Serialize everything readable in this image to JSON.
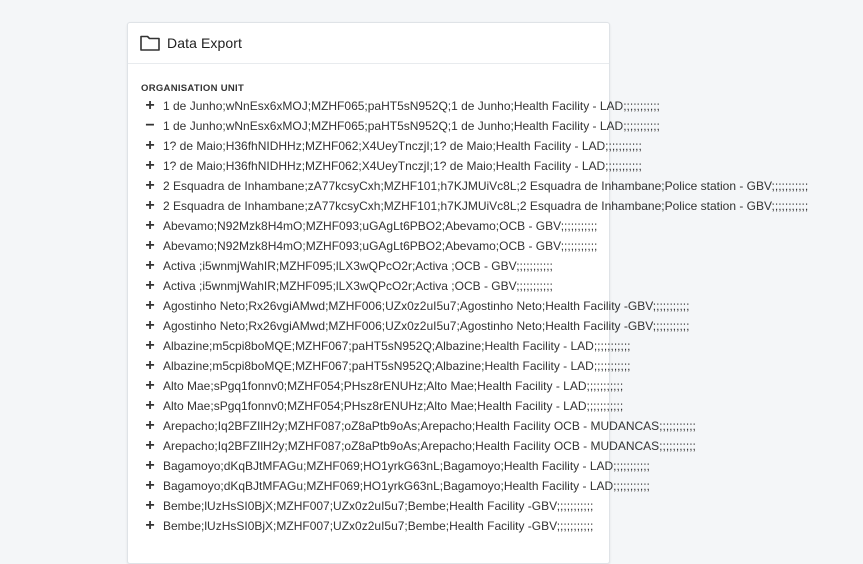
{
  "panel": {
    "title": "Data Export",
    "section_label": "ORGANISATION UNIT",
    "icon": "folder-icon"
  },
  "tree": {
    "items": [
      {
        "toggle": "+",
        "label": "1 de Junho;wNnEsx6xMOJ;MZHF065;paHT5sN952Q;1 de Junho;Health Facility - LAD;;;;;;;;;;;"
      },
      {
        "toggle": "−",
        "label": "1 de Junho;wNnEsx6xMOJ;MZHF065;paHT5sN952Q;1 de Junho;Health Facility - LAD;;;;;;;;;;;"
      },
      {
        "toggle": "+",
        "label": "1? de Maio;H36fhNIDHHz;MZHF062;X4UeyTnczjI;1? de Maio;Health Facility - LAD;;;;;;;;;;;"
      },
      {
        "toggle": "+",
        "label": "1? de Maio;H36fhNIDHHz;MZHF062;X4UeyTnczjI;1? de Maio;Health Facility - LAD;;;;;;;;;;;"
      },
      {
        "toggle": "+",
        "label": "2 Esquadra de Inhambane;zA77kcsyCxh;MZHF101;h7KJMUiVc8L;2 Esquadra de Inhambane;Police station - GBV;;;;;;;;;;;"
      },
      {
        "toggle": "+",
        "label": "2 Esquadra de Inhambane;zA77kcsyCxh;MZHF101;h7KJMUiVc8L;2 Esquadra de Inhambane;Police station - GBV;;;;;;;;;;;"
      },
      {
        "toggle": "+",
        "label": "Abevamo;N92Mzk8H4mO;MZHF093;uGAgLt6PBO2;Abevamo;OCB - GBV;;;;;;;;;;;"
      },
      {
        "toggle": "+",
        "label": "Abevamo;N92Mzk8H4mO;MZHF093;uGAgLt6PBO2;Abevamo;OCB - GBV;;;;;;;;;;;"
      },
      {
        "toggle": "+",
        "label": "Activa ;i5wnmjWahIR;MZHF095;lLX3wQPcO2r;Activa ;OCB - GBV;;;;;;;;;;;"
      },
      {
        "toggle": "+",
        "label": "Activa ;i5wnmjWahIR;MZHF095;lLX3wQPcO2r;Activa ;OCB - GBV;;;;;;;;;;;"
      },
      {
        "toggle": "+",
        "label": "Agostinho Neto;Rx26vgiAMwd;MZHF006;UZx0z2uI5u7;Agostinho Neto;Health Facility -GBV;;;;;;;;;;;"
      },
      {
        "toggle": "+",
        "label": "Agostinho Neto;Rx26vgiAMwd;MZHF006;UZx0z2uI5u7;Agostinho Neto;Health Facility -GBV;;;;;;;;;;;"
      },
      {
        "toggle": "+",
        "label": "Albazine;m5cpi8boMQE;MZHF067;paHT5sN952Q;Albazine;Health Facility - LAD;;;;;;;;;;;"
      },
      {
        "toggle": "+",
        "label": "Albazine;m5cpi8boMQE;MZHF067;paHT5sN952Q;Albazine;Health Facility - LAD;;;;;;;;;;;"
      },
      {
        "toggle": "+",
        "label": "Alto Mae;sPgq1fonnv0;MZHF054;PHsz8rENUHz;Alto Mae;Health Facility - LAD;;;;;;;;;;;"
      },
      {
        "toggle": "+",
        "label": "Alto Mae;sPgq1fonnv0;MZHF054;PHsz8rENUHz;Alto Mae;Health Facility - LAD;;;;;;;;;;;"
      },
      {
        "toggle": "+",
        "label": "Arepacho;Iq2BFZIlH2y;MZHF087;oZ8aPtb9oAs;Arepacho;Health Facility OCB - MUDANCAS;;;;;;;;;;;"
      },
      {
        "toggle": "+",
        "label": "Arepacho;Iq2BFZIlH2y;MZHF087;oZ8aPtb9oAs;Arepacho;Health Facility OCB - MUDANCAS;;;;;;;;;;;"
      },
      {
        "toggle": "+",
        "label": "Bagamoyo;dKqBJtMFAGu;MZHF069;HO1yrkG63nL;Bagamoyo;Health Facility - LAD;;;;;;;;;;;"
      },
      {
        "toggle": "+",
        "label": "Bagamoyo;dKqBJtMFAGu;MZHF069;HO1yrkG63nL;Bagamoyo;Health Facility - LAD;;;;;;;;;;;"
      },
      {
        "toggle": "+",
        "label": "Bembe;lUzHsSI0BjX;MZHF007;UZx0z2uI5u7;Bembe;Health Facility -GBV;;;;;;;;;;;"
      },
      {
        "toggle": "+",
        "label": "Bembe;lUzHsSI0BjX;MZHF007;UZx0z2uI5u7;Bembe;Health Facility -GBV;;;;;;;;;;;"
      }
    ]
  }
}
